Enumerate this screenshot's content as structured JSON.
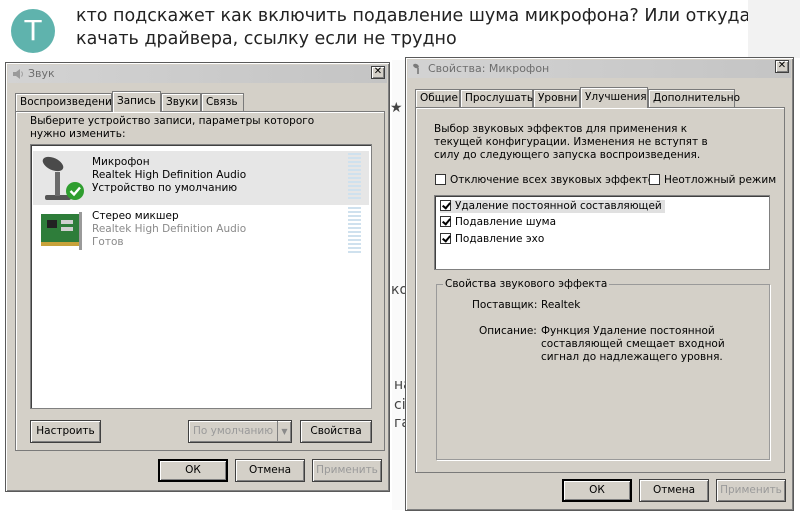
{
  "question": {
    "avatar_letter": "T",
    "text": "кто подскажет как включить подавление шума микрофона? Или откуда качать драйвера, ссылку если не трудно"
  },
  "background_fragments": [
    "★",
    "ко",
    "на",
    "сі",
    "га"
  ],
  "sound_dialog": {
    "title": "Звук",
    "close_label": "✕",
    "tabs": [
      "Воспроизведение",
      "Запись",
      "Звуки",
      "Связь"
    ],
    "active_tab": "Запись",
    "instruction": "Выберите устройство записи, параметры которого нужно изменить:",
    "devices": [
      {
        "name": "Микрофон",
        "driver": "Realtek High Definition Audio",
        "status": "Устройство по умолчанию",
        "selected": true
      },
      {
        "name": "Стерео микшер",
        "driver": "Realtek High Definition Audio",
        "status": "Готов",
        "selected": false
      }
    ],
    "configure_button": "Настроить",
    "set_default_button": "По умолчанию",
    "properties_button": "Свойства",
    "ok_button": "ОК",
    "cancel_button": "Отмена",
    "apply_button": "Применить"
  },
  "mic_dialog": {
    "title": "Свойства: Микрофон",
    "close_label": "✕",
    "tabs": [
      "Общие",
      "Прослушать",
      "Уровни",
      "Улучшения",
      "Дополнительно"
    ],
    "active_tab": "Улучшения",
    "description": "Выбор звуковых эффектов для применения к текущей конфигурации. Изменения не вступят в силу до следующего запуска воспроизведения.",
    "disable_all_label": "Отключение всех звуковых эффектов",
    "disable_all_checked": false,
    "urgent_mode_label": "Неотложный режим",
    "urgent_mode_checked": false,
    "effects": [
      {
        "label": "Удаление постоянной составляющей",
        "checked": true,
        "selected": true
      },
      {
        "label": "Подавление шума",
        "checked": true,
        "selected": false
      },
      {
        "label": "Подавление эхо",
        "checked": true,
        "selected": false
      }
    ],
    "effect_properties_title": "Свойства звукового эффекта",
    "provider_label": "Поставщик:",
    "provider_value": "Realtek",
    "description_label": "Описание:",
    "description_value": "Функция Удаление постоянной составляющей смещает входной сигнал до надлежащего уровня.",
    "ok_button": "ОК",
    "cancel_button": "Отмена",
    "apply_button": "Применить"
  }
}
